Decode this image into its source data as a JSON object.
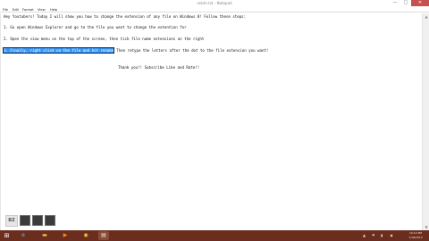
{
  "window": {
    "title": "rakim.txt - Notepad",
    "minimize_glyph": "—",
    "maximize_glyph": "□",
    "close_glyph": "✕"
  },
  "menu": [
    "File",
    "Edit",
    "Format",
    "View",
    "Help"
  ],
  "document": {
    "line1": "Hey Youtubers! Today I will show you how to change the extension of any file on Windows 8! Follow these steps:",
    "line2": "1. Go open Windows Explorer and go to the file you want to change the extention for",
    "line3": "2. Open the view menu on the top of the screen, then tick file name extensions on the right",
    "line4_selected": "3. Finally, right click on the file and hit rename",
    "line4_rest": " Then retype the letters after the dot to the file extension you want!",
    "line5": "Thank you!! Subscribe Like and Rate!!"
  },
  "watermark": {
    "logo_text": "BZ"
  },
  "taskbar": {
    "start_glyph": "⊞",
    "icons": [
      "internet-explorer-icon",
      "folder-icon",
      "media-player-icon",
      "chrome-icon",
      "notepad-icon"
    ],
    "ie_glyph": "e",
    "folder_glyph": "▬",
    "media_glyph": "▶",
    "chrome_glyph": "◉",
    "notepad_glyph": "▤",
    "tray_up_glyph": "▲",
    "tray_flag_glyph": "⚑",
    "tray_network_glyph": "▮",
    "tray_volume_glyph": "◀",
    "clock_time": "10:12 PM",
    "clock_date": "7/18/2013"
  },
  "colors": {
    "selection": "#3399ff",
    "taskbar": "#6b2d1e",
    "close_button": "#c75050"
  }
}
